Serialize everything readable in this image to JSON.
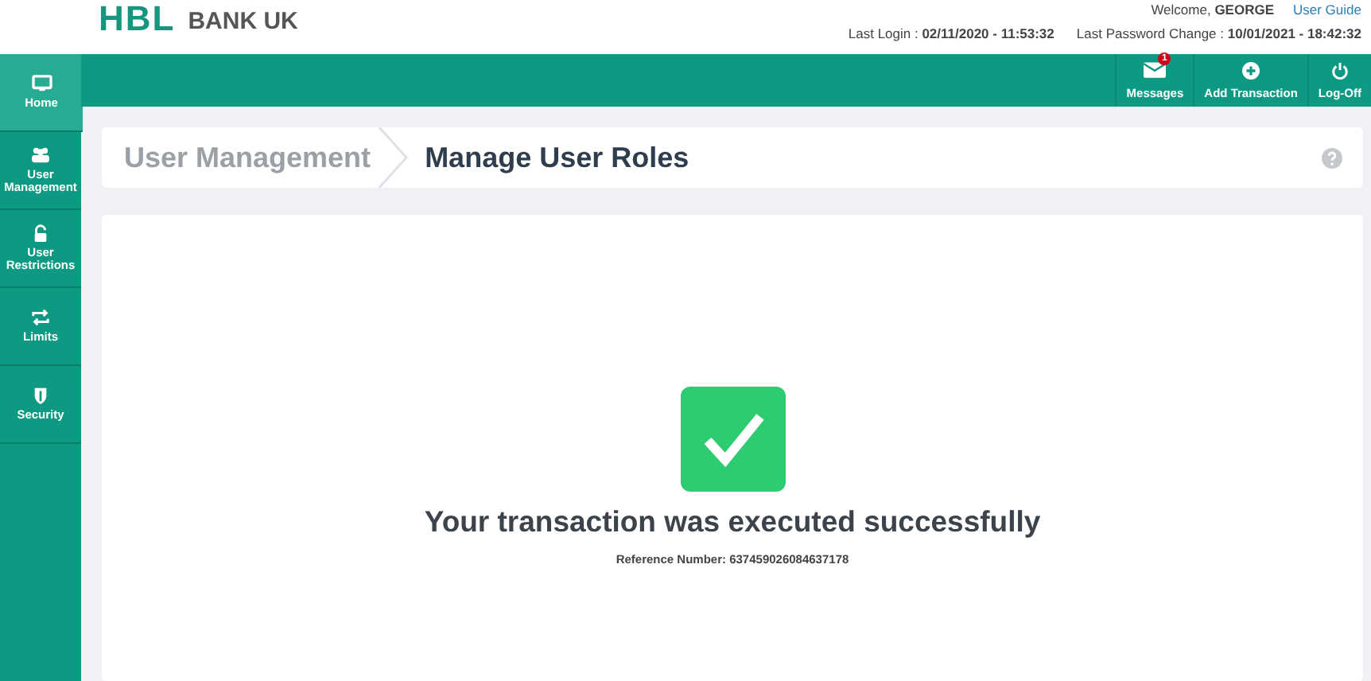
{
  "logo": {
    "mark": "HBL",
    "name": "BANK UK"
  },
  "header": {
    "welcome": "Welcome,",
    "user": "GEORGE",
    "guide": "User Guide",
    "last_login_label": "Last Login :",
    "last_login": "02/11/2020 - 11:53:32",
    "last_pw_label": "Last Password Change :",
    "last_pw": "10/01/2021 - 18:42:32"
  },
  "toolbar": [
    {
      "kind": "messages",
      "label": "Messages",
      "badge": "1"
    },
    {
      "kind": "add",
      "label": "Add Transaction"
    },
    {
      "kind": "logoff",
      "label": "Log-Off"
    }
  ],
  "sidebar": {
    "items": [
      {
        "kind": "home",
        "label": "Home",
        "selected": true
      },
      {
        "kind": "users",
        "label": "User Management",
        "selected": false
      },
      {
        "kind": "lock",
        "label": "User Restrictions",
        "selected": false
      },
      {
        "kind": "limits",
        "label": "Limits",
        "selected": false
      },
      {
        "kind": "shield",
        "label": "Security",
        "selected": false
      }
    ]
  },
  "breadcrumb": [
    {
      "label": "User Management",
      "selected": false
    },
    {
      "label": "Manage User Roles",
      "selected": true
    }
  ],
  "result": {
    "message": "Your transaction was executed successfully",
    "reference_label": "Reference Number:",
    "reference": "637459026084637178"
  }
}
